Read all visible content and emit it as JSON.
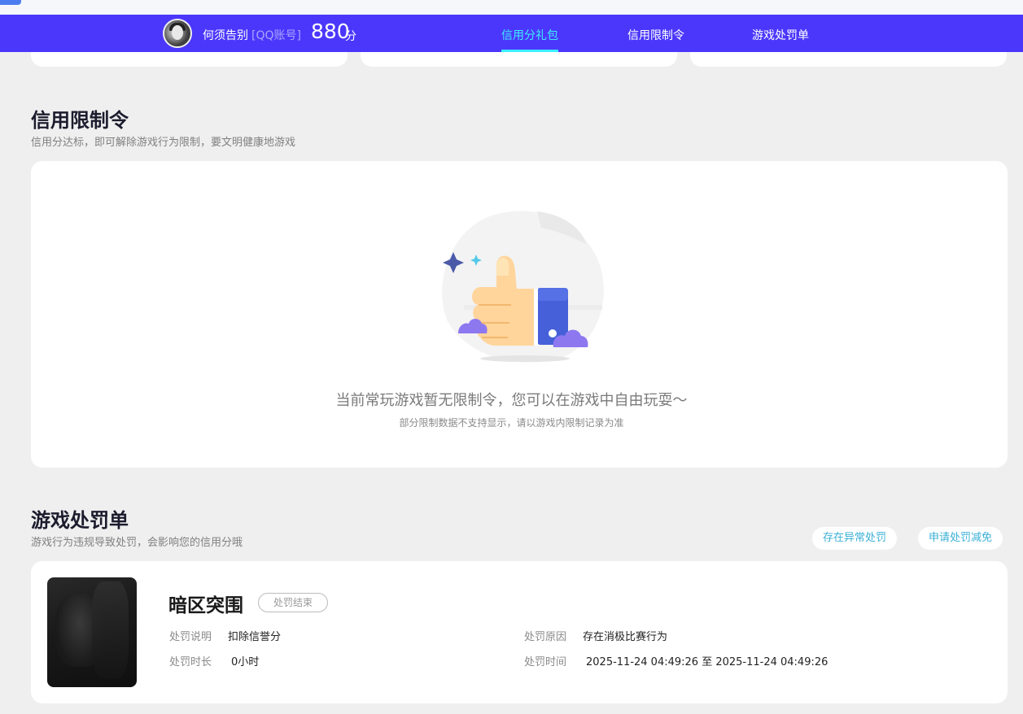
{
  "header": {
    "username": "何须告别",
    "account_type": "[QQ账号]",
    "score": "880",
    "score_unit": "分",
    "tabs": [
      {
        "label": "信用分礼包",
        "active": true
      },
      {
        "label": "信用限制令",
        "active": false
      },
      {
        "label": "游戏处罚单",
        "active": false
      }
    ]
  },
  "restriction": {
    "title": "信用限制令",
    "subtitle": "信用分达标，即可解除游戏行为限制，要文明健康地游戏",
    "empty_message": "当前常玩游戏暂无限制令，您可以在游戏中自由玩耍～",
    "empty_note": "部分限制数据不支持显示，请以游戏内限制记录为准"
  },
  "penalty": {
    "title": "游戏处罚单",
    "subtitle": "游戏行为违规导致处罚，会影响您的信用分哦",
    "abnormal_button": "存在异常处罚",
    "appeal_button": "申请处罚减免",
    "record": {
      "game": "暗区突围",
      "status": "处罚结束",
      "desc_label": "处罚说明",
      "desc_value": "扣除信誉分",
      "reason_label": "处罚原因",
      "reason_value": "存在消极比赛行为",
      "duration_label": "处罚时长",
      "duration_value": "0小时",
      "time_label": "处罚时间",
      "time_value": "2025-11-24 04:49:26 至 2025-11-24 04:49:26"
    }
  },
  "colors": {
    "nav_bg": "#4b37fc",
    "accent": "#3cf0ff",
    "link": "#3ab0d6"
  }
}
